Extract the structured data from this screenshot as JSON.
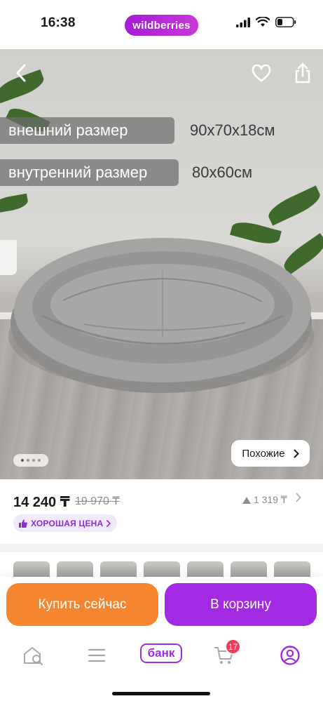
{
  "status_bar": {
    "time": "16:38",
    "brand": "wildberries"
  },
  "photo": {
    "overlay": [
      {
        "label": "внешний размер",
        "value": "90x70x18см"
      },
      {
        "label": "внутренний размер",
        "value": "80x60см"
      }
    ],
    "similar_label": "Похожие",
    "icons": {
      "back": "chevron-left-icon",
      "favorite": "heart-icon",
      "share": "share-icon",
      "similar_arrow": "chevron-right-icon"
    },
    "dots_count": 4
  },
  "price": {
    "current": "14 240 ₸",
    "old": "19 970 ₸",
    "bonus": "1 319 ₸",
    "good_price_label": "ХОРОШАЯ ЦЕНА"
  },
  "actions": {
    "buy_now": "Купить сейчас",
    "add_to_cart": "В корзину"
  },
  "bottom_nav": {
    "bank": "банк",
    "cart_badge": "17"
  },
  "colors": {
    "brand": "#a32ae3",
    "buy": "#f5862f",
    "badge": "#f03b5d"
  }
}
